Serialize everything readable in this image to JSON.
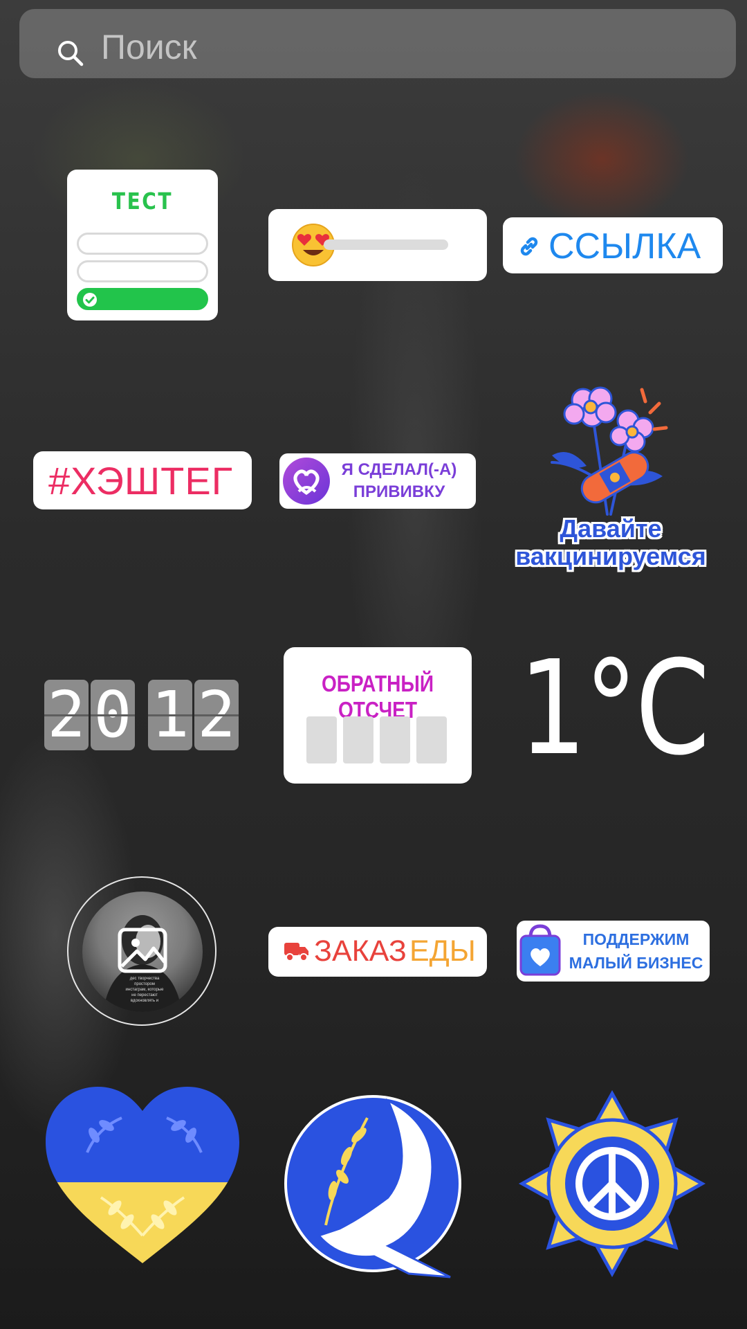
{
  "search": {
    "placeholder": "Поиск"
  },
  "stickers": {
    "quiz": {
      "label": "ТЕСТ"
    },
    "emoji_slider": {
      "emoji": "😍"
    },
    "link": {
      "label": "ССЫЛКА"
    },
    "hashtag": {
      "label": "#ХЭШТЕГ"
    },
    "vaccinated": {
      "line1": "Я СДЕЛАЛ(-А)",
      "line2": "ПРИВИВКУ"
    },
    "lets_vaccinate": {
      "line1": "Давайте",
      "line2": "вакцинируемся"
    },
    "date": {
      "d1": "2",
      "d2": "0",
      "d3": "1",
      "d4": "2"
    },
    "countdown": {
      "label": "ОБРАТНЫЙ ОТСЧЕТ"
    },
    "weather": {
      "temp": "1°C"
    },
    "photo": {
      "caption": "дес творчества простором инстаграм, которые не перестают вдохновлять и"
    },
    "food_order": {
      "part1": "ЗАКАЗ",
      "part2": "ЕДЫ"
    },
    "small_business": {
      "line1": "ПОДДЕРЖИМ",
      "line2": "МАЛЫЙ БИЗНЕС"
    }
  },
  "colors": {
    "quiz_green": "#22c44b",
    "link_blue": "#1e88ee",
    "hashtag_pink": "#ec2d63",
    "vacc_purple": "#7a3ed8",
    "countdown_magenta": "#c921c4",
    "ukraine_blue": "#2a52e0",
    "ukraine_yellow": "#f7d858",
    "food_red": "#e8423c",
    "food_orange": "#f4a533"
  }
}
